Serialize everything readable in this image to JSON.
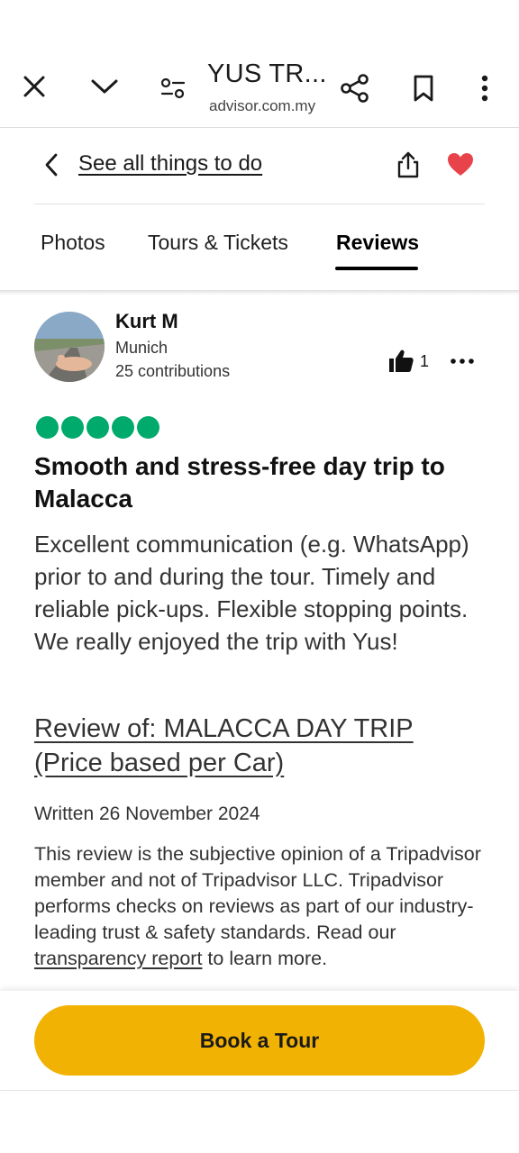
{
  "browser": {
    "title": "YUS TR...",
    "url": "advisor.com.my",
    "icons": [
      "close-icon",
      "chevron-down-icon",
      "tune-icon",
      "share-icon",
      "bookmark-icon",
      "more-vert-icon"
    ]
  },
  "header": {
    "back_label": "See all things to do",
    "icons": [
      "chevron-left-icon",
      "upload-icon",
      "heart-icon"
    ],
    "heart_color": "#e8434a"
  },
  "tabs": [
    {
      "label": "Photos",
      "active": false
    },
    {
      "label": "Tours & Tickets",
      "active": false
    },
    {
      "label": "Reviews",
      "active": true
    }
  ],
  "review": {
    "reviewer": {
      "name": "Kurt M",
      "location": "Munich",
      "contributions": "25 contributions"
    },
    "helpful_count": "1",
    "rating": 5,
    "rating_color": "#00aa6c",
    "title": "Smooth and stress-free day trip to Malacca",
    "body": "Excellent communication (e.g. WhatsApp) prior to and during the tour. Timely and reliable pick-ups. Flexible stopping points. We really enjoyed the trip with Yus!",
    "review_of": "Review of: MALACCA DAY TRIP (Price based per Car)",
    "written": "Written 26 November 2024",
    "disclaimer_text": "This review is the subjective opinion of a Tripadvisor member and not of Tripadvisor LLC. Tripadvisor performs checks on reviews as part of our industry-leading trust & safety standards. Read our ",
    "disclaimer_link": "transparency report",
    "disclaimer_tail": " to learn more."
  },
  "cta": {
    "label": "Book a Tour",
    "color": "#f2b203"
  }
}
